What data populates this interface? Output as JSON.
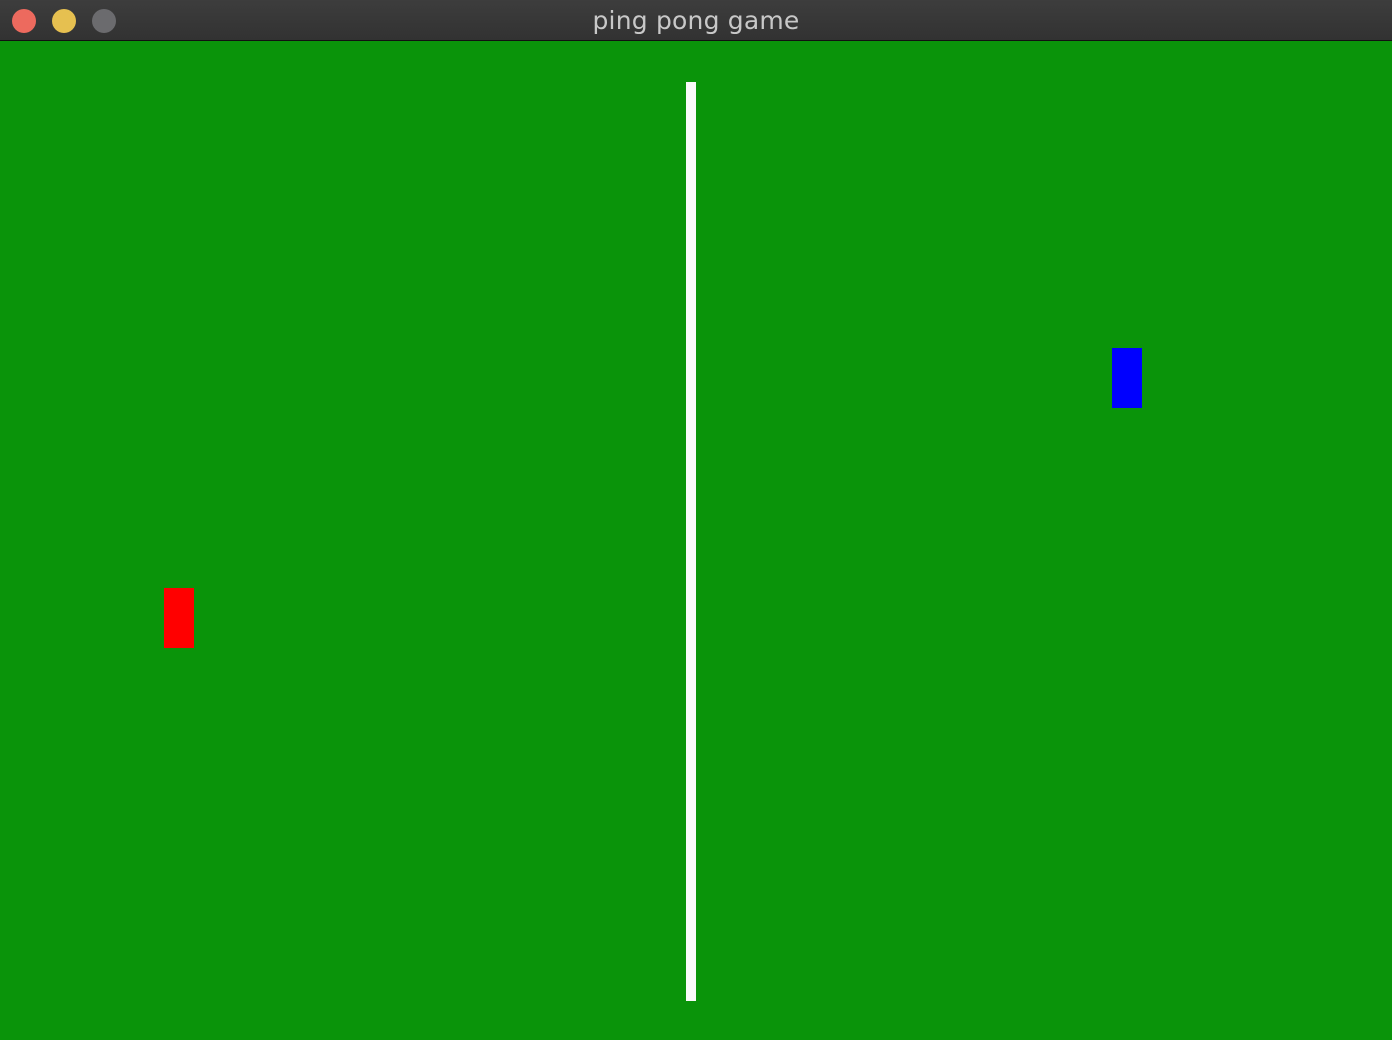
{
  "window": {
    "title": "ping pong game"
  },
  "controls": {
    "close_icon": "close-icon",
    "minimize_icon": "minimize-icon",
    "zoom_icon": "zoom-icon"
  },
  "colors": {
    "close": "#ed6a5e",
    "minimize": "#e6c050",
    "zoom": "#6b6b6e",
    "table": "#0a940a",
    "net": "#fafafa",
    "left_paddle": "#ff0000",
    "right_paddle": "#0000ff"
  },
  "game": {
    "left_paddle": {
      "color_name": "red"
    },
    "right_paddle": {
      "color_name": "blue"
    }
  }
}
